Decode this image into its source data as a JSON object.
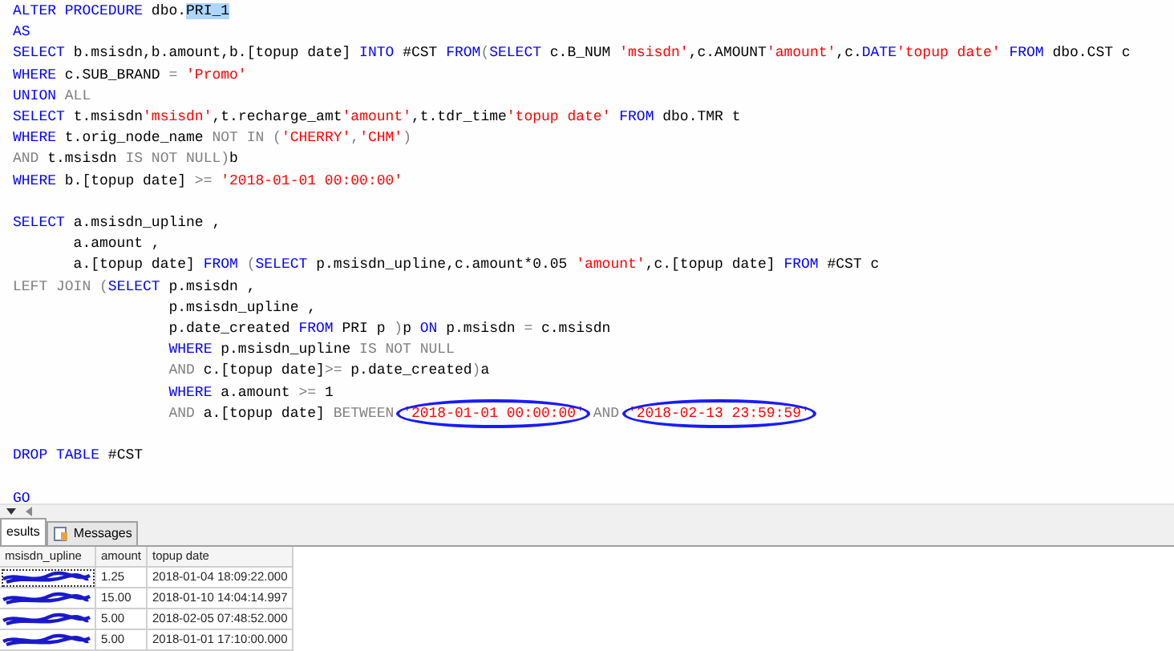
{
  "editor": {
    "lines": [
      {
        "segments": [
          {
            "kind": "keyword",
            "text": "ALTER PROCEDURE "
          },
          {
            "kind": "plain",
            "text": "dbo."
          },
          {
            "kind": "plain",
            "text": "PRI_1",
            "highlighted": true
          }
        ]
      },
      {
        "segments": [
          {
            "kind": "keyword",
            "text": "AS"
          }
        ]
      },
      {
        "segments": [
          {
            "kind": "keyword",
            "text": "SELECT "
          },
          {
            "kind": "plain",
            "text": "b.msisdn,b.amount,b.[topup date] "
          },
          {
            "kind": "keyword",
            "text": "INTO "
          },
          {
            "kind": "plain",
            "text": "#CST "
          },
          {
            "kind": "keyword",
            "text": "FROM"
          },
          {
            "kind": "operator",
            "text": "("
          },
          {
            "kind": "keyword",
            "text": "SELECT "
          },
          {
            "kind": "plain",
            "text": "c.B_NUM "
          },
          {
            "kind": "string",
            "text": "'msisdn'"
          },
          {
            "kind": "plain",
            "text": ",c.AMOUNT"
          },
          {
            "kind": "string",
            "text": "'amount'"
          },
          {
            "kind": "plain",
            "text": ",c."
          },
          {
            "kind": "keyword",
            "text": "DATE"
          },
          {
            "kind": "string",
            "text": "'topup date'"
          },
          {
            "kind": "keyword",
            "text": " FROM "
          },
          {
            "kind": "plain",
            "text": "dbo.CST c"
          }
        ]
      },
      {
        "segments": [
          {
            "kind": "keyword",
            "text": "WHERE "
          },
          {
            "kind": "plain",
            "text": "c.SUB_BRAND "
          },
          {
            "kind": "operator",
            "text": "= "
          },
          {
            "kind": "string",
            "text": "'Promo'"
          }
        ]
      },
      {
        "segments": [
          {
            "kind": "keyword",
            "text": "UNION "
          },
          {
            "kind": "operator",
            "text": "ALL"
          }
        ]
      },
      {
        "segments": [
          {
            "kind": "keyword",
            "text": "SELECT "
          },
          {
            "kind": "plain",
            "text": "t.msisdn"
          },
          {
            "kind": "string",
            "text": "'msisdn'"
          },
          {
            "kind": "plain",
            "text": ",t.recharge_amt"
          },
          {
            "kind": "string",
            "text": "'amount'"
          },
          {
            "kind": "plain",
            "text": ",t.tdr_time"
          },
          {
            "kind": "string",
            "text": "'topup date'"
          },
          {
            "kind": "keyword",
            "text": " FROM "
          },
          {
            "kind": "plain",
            "text": "dbo.TMR t"
          }
        ]
      },
      {
        "segments": [
          {
            "kind": "keyword",
            "text": "WHERE "
          },
          {
            "kind": "plain",
            "text": "t.orig_node_name "
          },
          {
            "kind": "operator",
            "text": "NOT IN ("
          },
          {
            "kind": "string",
            "text": "'CHERRY'"
          },
          {
            "kind": "operator",
            "text": ","
          },
          {
            "kind": "string",
            "text": "'CHM'"
          },
          {
            "kind": "operator",
            "text": ")"
          }
        ]
      },
      {
        "segments": [
          {
            "kind": "operator",
            "text": "AND "
          },
          {
            "kind": "plain",
            "text": "t.msisdn "
          },
          {
            "kind": "operator",
            "text": "IS NOT NULL)"
          },
          {
            "kind": "plain",
            "text": "b"
          }
        ]
      },
      {
        "segments": [
          {
            "kind": "keyword",
            "text": "WHERE "
          },
          {
            "kind": "plain",
            "text": "b.[topup date] "
          },
          {
            "kind": "operator",
            "text": ">= "
          },
          {
            "kind": "string",
            "text": "'2018-01-01 00:00:00'"
          }
        ]
      },
      {
        "blank_before": true,
        "segments": [
          {
            "kind": "keyword",
            "text": "SELECT "
          },
          {
            "kind": "plain",
            "text": "a.msisdn_upline ,"
          }
        ]
      },
      {
        "segments": [
          {
            "kind": "plain",
            "text": "       a.amount ,"
          }
        ]
      },
      {
        "segments": [
          {
            "kind": "plain",
            "text": "       a.[topup date] "
          },
          {
            "kind": "keyword",
            "text": "FROM "
          },
          {
            "kind": "operator",
            "text": "("
          },
          {
            "kind": "keyword",
            "text": "SELECT "
          },
          {
            "kind": "plain",
            "text": "p.msisdn_upline,c.amount*0.05 "
          },
          {
            "kind": "string",
            "text": "'amount'"
          },
          {
            "kind": "plain",
            "text": ",c.[topup date] "
          },
          {
            "kind": "keyword",
            "text": "FROM "
          },
          {
            "kind": "plain",
            "text": "#CST c"
          }
        ]
      },
      {
        "segments": [
          {
            "kind": "operator",
            "text": "LEFT JOIN ("
          },
          {
            "kind": "keyword",
            "text": "SELECT "
          },
          {
            "kind": "plain",
            "text": "p.msisdn ,"
          }
        ]
      },
      {
        "segments": [
          {
            "kind": "plain",
            "text": "                  p.msisdn_upline ,"
          }
        ]
      },
      {
        "segments": [
          {
            "kind": "plain",
            "text": "                  p.date_created "
          },
          {
            "kind": "keyword",
            "text": "FROM "
          },
          {
            "kind": "plain",
            "text": "PRI p "
          },
          {
            "kind": "operator",
            "text": ")"
          },
          {
            "kind": "plain",
            "text": "p "
          },
          {
            "kind": "keyword",
            "text": "ON "
          },
          {
            "kind": "plain",
            "text": "p.msisdn "
          },
          {
            "kind": "operator",
            "text": "= "
          },
          {
            "kind": "plain",
            "text": "c.msisdn"
          }
        ]
      },
      {
        "segments": [
          {
            "kind": "keyword",
            "text": "                  WHERE "
          },
          {
            "kind": "plain",
            "text": "p.msisdn_upline "
          },
          {
            "kind": "operator",
            "text": "IS NOT NULL"
          }
        ]
      },
      {
        "segments": [
          {
            "kind": "operator",
            "text": "                  AND "
          },
          {
            "kind": "plain",
            "text": "c.[topup date]"
          },
          {
            "kind": "operator",
            "text": ">= "
          },
          {
            "kind": "plain",
            "text": "p.date_created"
          },
          {
            "kind": "operator",
            "text": ")"
          },
          {
            "kind": "plain",
            "text": "a"
          }
        ]
      },
      {
        "segments": [
          {
            "kind": "keyword",
            "text": "                  WHERE "
          },
          {
            "kind": "plain",
            "text": "a.amount "
          },
          {
            "kind": "operator",
            "text": ">= "
          },
          {
            "kind": "plain",
            "text": "1"
          }
        ]
      },
      {
        "segments": [
          {
            "kind": "operator",
            "text": "                  AND "
          },
          {
            "kind": "plain",
            "text": "a.[topup date] "
          },
          {
            "kind": "operator",
            "text": "BETWEEN "
          },
          {
            "kind": "string",
            "text": "'2018-01-01 00:00:00'",
            "circled": true
          },
          {
            "kind": "operator",
            "text": " AND "
          },
          {
            "kind": "string",
            "text": "'2018-02-13 23:59:59'",
            "circled": true
          }
        ]
      },
      {
        "blank_before": true,
        "segments": [
          {
            "kind": "keyword",
            "text": "DROP TABLE "
          },
          {
            "kind": "plain",
            "text": "#CST"
          }
        ]
      },
      {
        "blank_before": true,
        "segments": [
          {
            "kind": "keyword",
            "text": "GO"
          }
        ]
      }
    ]
  },
  "tabs": [
    {
      "label": "esults",
      "selected": true
    },
    {
      "label": "Messages",
      "selected": false
    }
  ],
  "grid": {
    "columns": [
      "msisdn_upline",
      "amount",
      "topup date"
    ],
    "rows": [
      {
        "amount": "1.25",
        "topup_date": "2018-01-04 18:09:22.000",
        "focused": true
      },
      {
        "amount": "15.00",
        "topup_date": "2018-01-10 14:04:14.997",
        "focused": false
      },
      {
        "amount": "5.00",
        "topup_date": "2018-02-05 07:48:52.000",
        "focused": false
      },
      {
        "amount": "5.00",
        "topup_date": "2018-01-01 17:10:00.000",
        "focused": false
      }
    ]
  }
}
